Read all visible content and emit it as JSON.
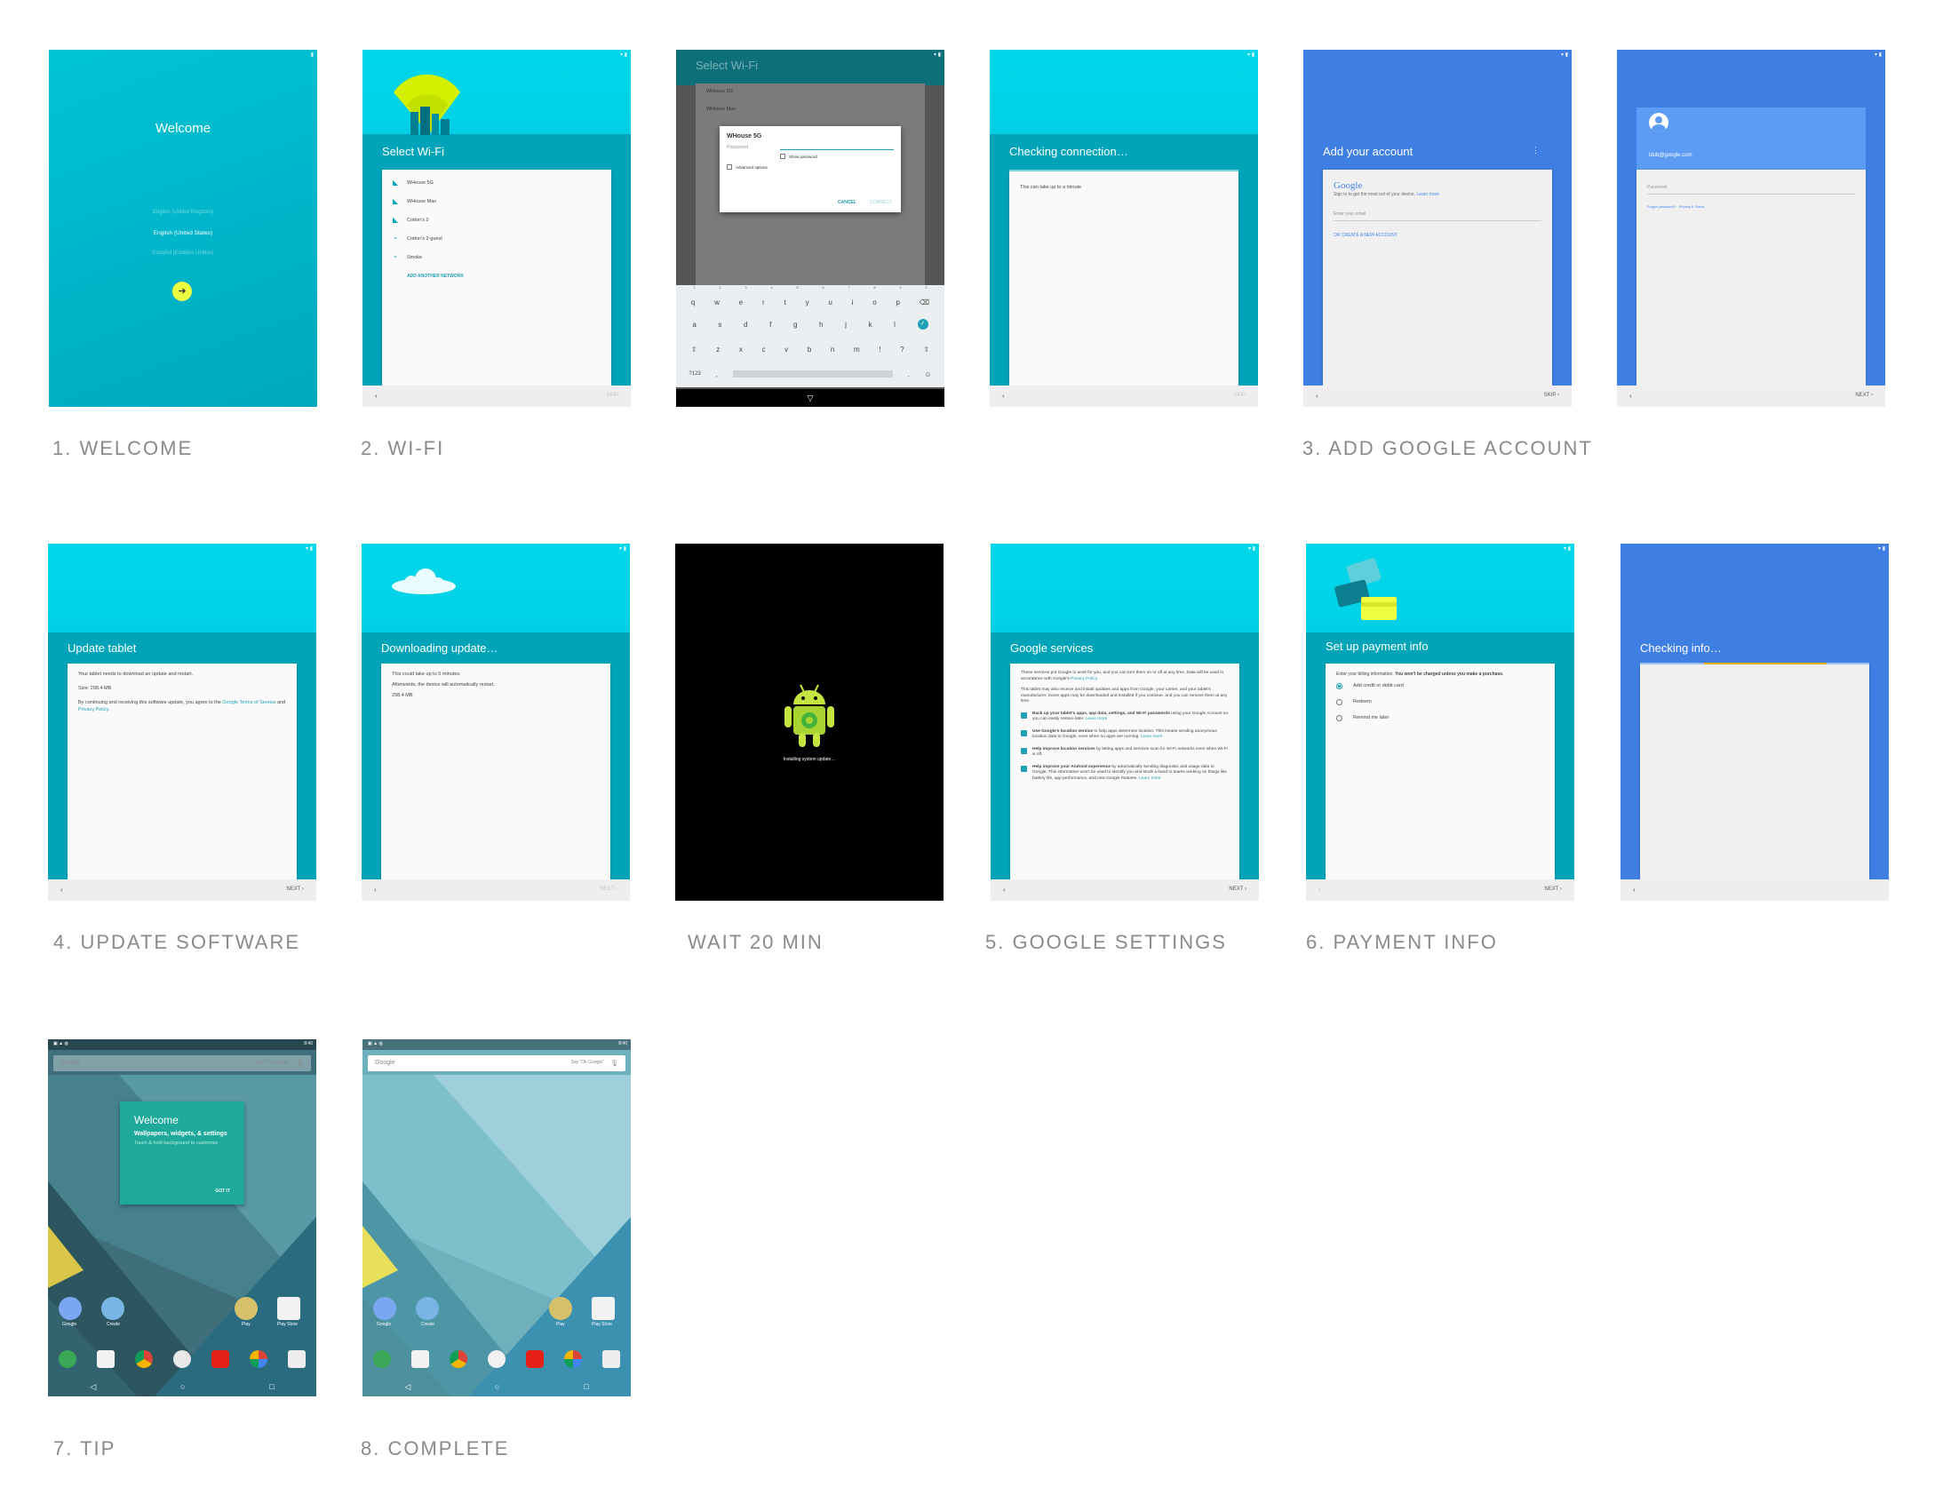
{
  "captions": {
    "welcome": "1. WELCOME",
    "wifi": "2. WI-FI",
    "account": "3. ADD GOOGLE ACCOUNT",
    "update": "4. UPDATE SOFTWARE",
    "wait": "WAIT 20 MIN",
    "settings": "5. GOOGLE SETTINGS",
    "payment": "6. PAYMENT INFO",
    "tip": "7. TIP",
    "complete": "8. COMPLETE"
  },
  "welcome": {
    "title": "Welcome",
    "languages": [
      "English (United Kingdom)",
      "English (United States)",
      "Español (Estados Unidos)"
    ]
  },
  "wifi": {
    "title": "Select Wi-Fi",
    "networks": [
      "WHouse 5G",
      "WHouse Max",
      "Cotton's 2",
      "Cotton's 2-guest",
      "Smoke"
    ],
    "add_network": "ADD ANOTHER NETWORK",
    "skip": "SKIP"
  },
  "wifi_dialog": {
    "bg_title": "Select Wi-Fi",
    "bg_networks": [
      "WHouse 5G",
      "WHouse Max"
    ],
    "network": "WHouse 5G",
    "password_label": "Password",
    "show_password": "Show password",
    "advanced": "Advanced options",
    "cancel": "CANCEL",
    "connect": "CONNECT",
    "numbers": [
      "1",
      "2",
      "3",
      "4",
      "5",
      "6",
      "7",
      "8",
      "9",
      "0"
    ],
    "row1": [
      "q",
      "w",
      "e",
      "r",
      "t",
      "y",
      "u",
      "i",
      "o",
      "p"
    ],
    "row2": [
      "a",
      "s",
      "d",
      "f",
      "g",
      "h",
      "j",
      "k",
      "l"
    ],
    "row3": [
      "z",
      "x",
      "c",
      "v",
      "b",
      "n",
      "m",
      "!",
      "?"
    ],
    "sym_key": "?123"
  },
  "checking": {
    "title": "Checking connection…",
    "body": "This can take up to a minute",
    "skip": "SKIP"
  },
  "add_account": {
    "title": "Add your account",
    "google": "Google",
    "signin": "Sign in to get the most out of your device.",
    "learn_more": "Learn more",
    "email_placeholder": "Enter your email",
    "create": "OR CREATE A NEW ACCOUNT",
    "skip": "SKIP"
  },
  "password": {
    "email": "ldub@google.com",
    "password_label": "Password",
    "forgot": "Forgot password?",
    "privacy": "Privacy & Terms",
    "next": "NEXT"
  },
  "update": {
    "title": "Update tablet",
    "line1": "Your tablet needs to download an update and restart.",
    "size": "Size: 298.4 MB",
    "terms_pre": "By continuing and receiving this software update, you agree to the",
    "terms_link": "Google Terms of Service",
    "and": "and",
    "privacy_link": "Privacy Policy.",
    "next": "NEXT"
  },
  "downloading": {
    "title": "Downloading update…",
    "line1": "This could take up to 5 minutes.",
    "line2": "Afterwards, the device will automatically restart.",
    "size": "298.4 MB",
    "next": "NEXT"
  },
  "installing": {
    "text": "Installing system update…"
  },
  "services": {
    "title": "Google services",
    "intro": "These services put Google to work for you, and you can turn them on or off at any time. Data will be used in accordance with Google's",
    "privacy_link": "Privacy Policy.",
    "para2": "This tablet may also receive and install updates and apps from Google, your carrier, and your tablet's manufacturer. Some apps may be downloaded and installed if you continue, and you can remove them at any time.",
    "items": [
      {
        "bold": "Back up your tablet's apps, app data, settings, and Wi-Fi passwords",
        "rest": "using your Google Account so you can easily restore later.",
        "link": "Learn more"
      },
      {
        "bold": "Use Google's location service",
        "rest": "to help apps determine location. This means sending anonymous location data to Google, even when no apps are running.",
        "link": "Learn more"
      },
      {
        "bold": "Help improve location services",
        "rest": "by letting apps and services scan for Wi-Fi networks even when Wi-Fi is off.",
        "link": ""
      },
      {
        "bold": "Help improve your Android experience",
        "rest": "by automatically sending diagnostic and usage data to Google. This information won't be used to identify you and lends a hand to teams working on things like battery life, app performance, and new Google features.",
        "link": "Learn more"
      }
    ],
    "next": "NEXT"
  },
  "payment": {
    "title": "Set up payment info",
    "intro": "Enter your billing information.",
    "intro_bold": "You won't be charged unless you make a purchase.",
    "options": [
      "Add credit or debit card",
      "Redeem",
      "Remind me later"
    ],
    "next": "NEXT"
  },
  "checking_info": {
    "title": "Checking info…"
  },
  "tip": {
    "search": "Google",
    "say": "Say \"Ok Google\"",
    "time": "8:40",
    "title": "Welcome",
    "subtitle": "Wallpapers, widgets, & settings",
    "body": "Touch & hold background to customize",
    "got_it": "GOT IT",
    "apps": [
      "Google",
      "Create",
      "Play",
      "Play Store"
    ]
  },
  "complete": {
    "search": "Google",
    "say": "Say \"Ok Google\"",
    "time": "8:40",
    "apps": [
      "Google",
      "Create",
      "Play",
      "Play Store"
    ]
  },
  "colors": {
    "teal": "#00a4b8",
    "cyan": "#00d7ea",
    "blue": "#3f7fe3",
    "yellow": "#eeff41"
  }
}
